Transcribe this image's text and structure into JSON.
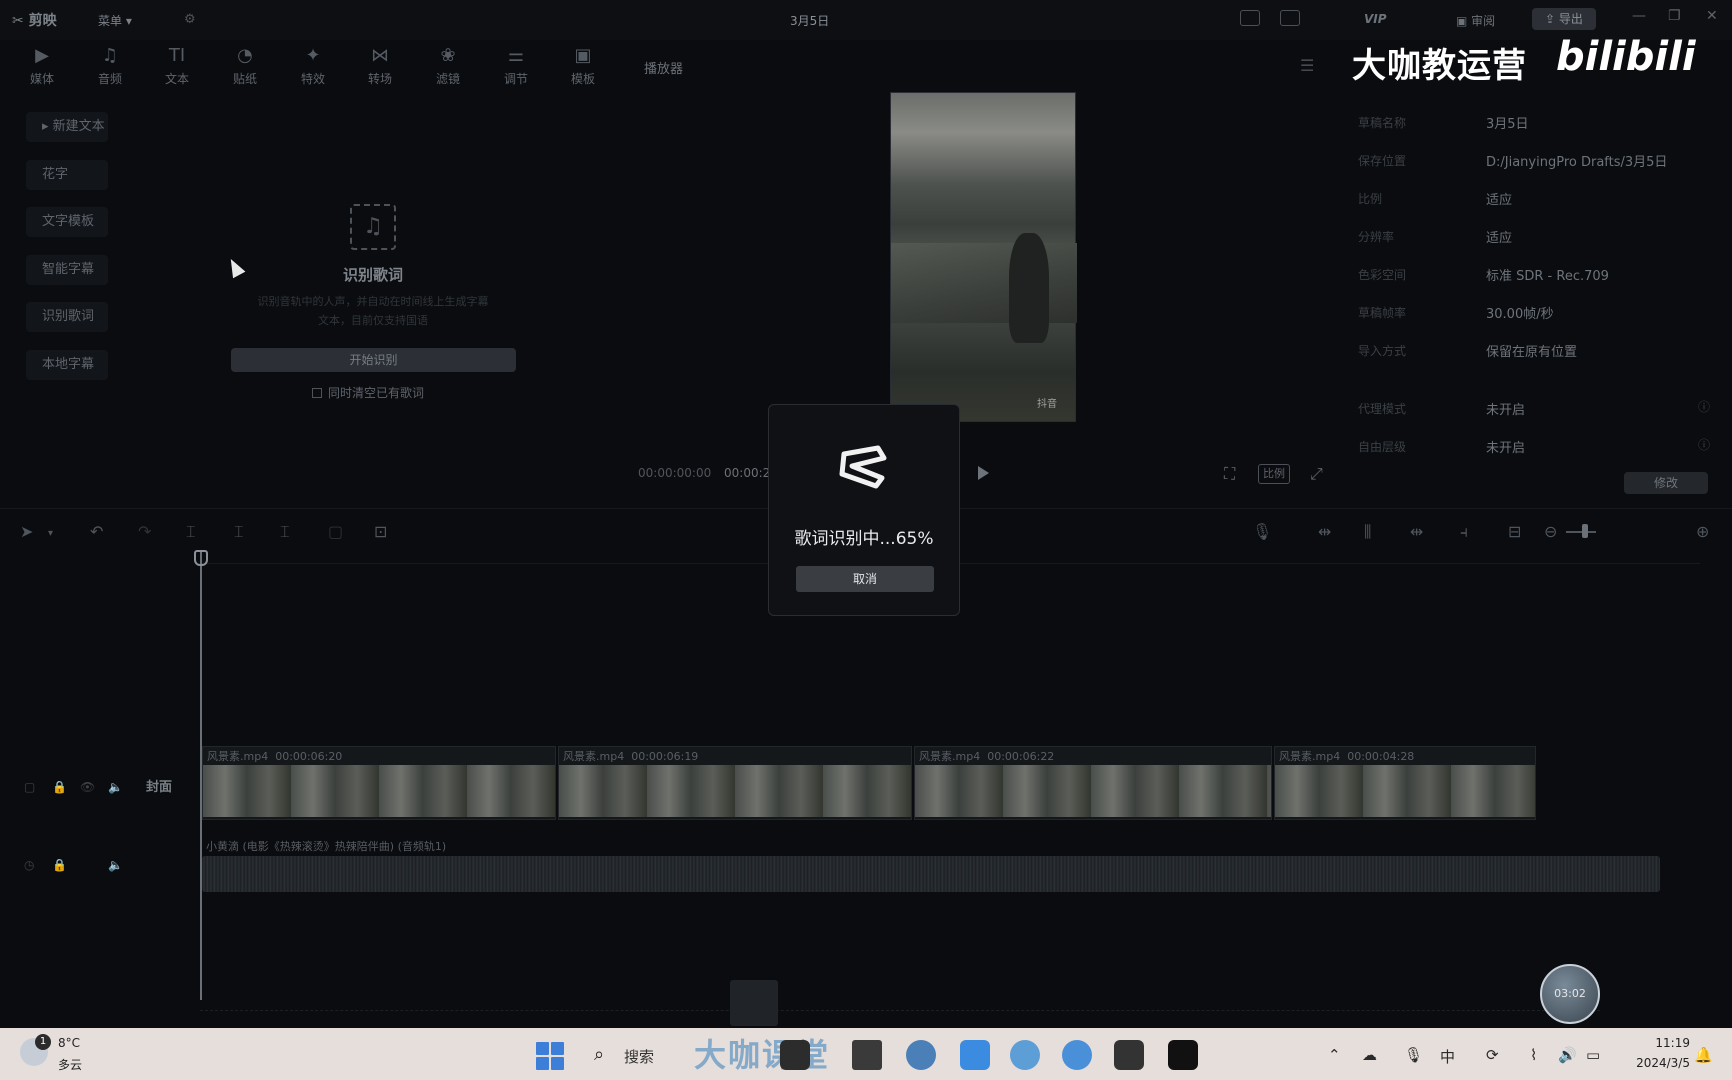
{
  "titlebar": {
    "app_name": "剪映",
    "menu_label": "菜单",
    "project_title": "3月5日",
    "vip": "VIP",
    "review": "审阅",
    "export": "导出"
  },
  "toolbar": {
    "tools": [
      {
        "label": "媒体",
        "icon": "▶"
      },
      {
        "label": "音频",
        "icon": "♫"
      },
      {
        "label": "文本",
        "icon": "TI"
      },
      {
        "label": "贴纸",
        "icon": "◔"
      },
      {
        "label": "特效",
        "icon": "✦"
      },
      {
        "label": "转场",
        "icon": "⋈"
      },
      {
        "label": "滤镜",
        "icon": "❀"
      },
      {
        "label": "调节",
        "icon": "⚌"
      },
      {
        "label": "模板",
        "icon": "▣"
      }
    ],
    "player_label": "播放器"
  },
  "text_panel": {
    "side_items": [
      "新建文本",
      "花字",
      "文字模板",
      "智能字幕",
      "识别歌词",
      "本地字幕"
    ],
    "lyrics": {
      "title": "识别歌词",
      "desc_line1": "识别音轨中的人声，并自动在时间线上生成字幕",
      "desc_line2": "文本，目前仅支持国语",
      "start_button": "开始识别",
      "clear_checkbox": "同时清空已有歌词"
    }
  },
  "player": {
    "current_time": "00:00:00:00",
    "total_time": "00:00:2",
    "ratio_label": "比例",
    "watermark": "抖音"
  },
  "brand": {
    "text": "大咖教运营",
    "logo": "bilibili"
  },
  "properties": {
    "rows": [
      {
        "key": "草稿名称",
        "value": "3月5日"
      },
      {
        "key": "保存位置",
        "value": "D:/JianyingPro Drafts/3月5日"
      },
      {
        "key": "比例",
        "value": "适应"
      },
      {
        "key": "分辨率",
        "value": "适应"
      },
      {
        "key": "色彩空间",
        "value": "标准 SDR - Rec.709"
      },
      {
        "key": "草稿帧率",
        "value": "30.00帧/秒"
      },
      {
        "key": "导入方式",
        "value": "保留在原有位置"
      },
      {
        "key": "代理模式",
        "value": "未开启"
      },
      {
        "key": "自由层级",
        "value": "未开启"
      }
    ],
    "modify_button": "修改"
  },
  "timeline": {
    "cover_label": "封面",
    "clips": [
      {
        "name": "风景素.mp4",
        "duration": "00:00:06:20"
      },
      {
        "name": "风景素.mp4",
        "duration": "00:00:06:19"
      },
      {
        "name": "风景素.mp4",
        "duration": "00:00:06:22"
      },
      {
        "name": "风景素.mp4",
        "duration": "00:00:04:28"
      }
    ],
    "audio_label": "小黄滴 (电影《热辣滚烫》热辣陪伴曲) (音频轨1)"
  },
  "modal": {
    "progress_text": "歌词识别中...65%",
    "progress": 0.65,
    "cancel": "取消"
  },
  "floating": {
    "ball_text": "03:02"
  },
  "taskbar": {
    "weather_badge": "1",
    "temperature": "8°C",
    "condition": "多云",
    "search": "搜索",
    "watermark": "大咖课堂",
    "time": "11:19",
    "date": "2024/3/5"
  }
}
